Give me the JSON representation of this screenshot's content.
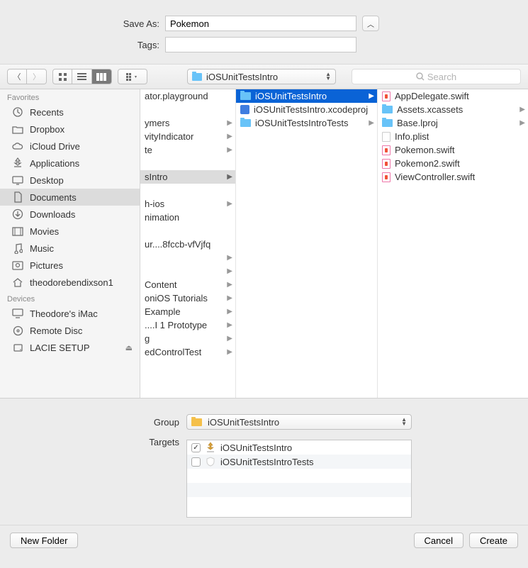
{
  "header": {
    "save_as_label": "Save As:",
    "save_as_value": "Pokemon",
    "tags_label": "Tags:",
    "tags_value": ""
  },
  "toolbar": {
    "path_label": "iOSUnitTestsIntro",
    "search_placeholder": "Search"
  },
  "sidebar": {
    "favorites_header": "Favorites",
    "devices_header": "Devices",
    "favorites": [
      {
        "label": "Recents",
        "icon": "clock"
      },
      {
        "label": "Dropbox",
        "icon": "folder-gray"
      },
      {
        "label": "iCloud Drive",
        "icon": "cloud"
      },
      {
        "label": "Applications",
        "icon": "apps"
      },
      {
        "label": "Desktop",
        "icon": "desktop"
      },
      {
        "label": "Documents",
        "icon": "doc",
        "selected": true
      },
      {
        "label": "Downloads",
        "icon": "download"
      },
      {
        "label": "Movies",
        "icon": "movie"
      },
      {
        "label": "Music",
        "icon": "music"
      },
      {
        "label": "Pictures",
        "icon": "picture"
      },
      {
        "label": "theodorebendixson1",
        "icon": "home"
      }
    ],
    "devices": [
      {
        "label": "Theodore's iMac",
        "icon": "imac"
      },
      {
        "label": "Remote Disc",
        "icon": "disc"
      },
      {
        "label": "LACIE SETUP",
        "icon": "drive",
        "eject": true
      }
    ]
  },
  "columns": {
    "col1": [
      {
        "label": "ator.playground",
        "type": "file"
      },
      {
        "label": "",
        "type": "spacer"
      },
      {
        "label": "ymers",
        "type": "folder",
        "arrow": true
      },
      {
        "label": "vityIndicator",
        "type": "folder",
        "arrow": true
      },
      {
        "label": "te",
        "type": "folder",
        "arrow": true
      },
      {
        "label": "",
        "type": "spacer"
      },
      {
        "label": "sIntro",
        "type": "folder",
        "arrow": true,
        "selected": true
      },
      {
        "label": "",
        "type": "spacer"
      },
      {
        "label": "h-ios",
        "type": "folder",
        "arrow": true
      },
      {
        "label": "nimation",
        "type": "text"
      },
      {
        "label": "",
        "type": "spacer"
      },
      {
        "label": "ur....8fccb-vfVjfq",
        "type": "text"
      },
      {
        "label": "",
        "type": "folder",
        "arrow": true
      },
      {
        "label": "",
        "type": "folder",
        "arrow": true
      },
      {
        "label": " Content",
        "type": "folder",
        "arrow": true
      },
      {
        "label": "oniOS Tutorials",
        "type": "folder",
        "arrow": true
      },
      {
        "label": "Example",
        "type": "folder",
        "arrow": true
      },
      {
        "label": "....I 1 Prototype",
        "type": "folder",
        "arrow": true
      },
      {
        "label": "g",
        "type": "folder",
        "arrow": true
      },
      {
        "label": "edControlTest",
        "type": "folder",
        "arrow": true
      }
    ],
    "col2": [
      {
        "label": "iOSUnitTestsIntro",
        "type": "folder",
        "arrow": true,
        "highlight": true
      },
      {
        "label": "iOSUnitTestsIntro.xcodeproj",
        "type": "proj"
      },
      {
        "label": "iOSUnitTestsIntroTests",
        "type": "folder",
        "arrow": true
      }
    ],
    "col3": [
      {
        "label": "AppDelegate.swift",
        "type": "swift"
      },
      {
        "label": "Assets.xcassets",
        "type": "folder",
        "arrow": true
      },
      {
        "label": "Base.lproj",
        "type": "folder",
        "arrow": true
      },
      {
        "label": "Info.plist",
        "type": "file"
      },
      {
        "label": "Pokemon.swift",
        "type": "swift"
      },
      {
        "label": "Pokemon2.swift",
        "type": "swift"
      },
      {
        "label": "ViewController.swift",
        "type": "swift"
      }
    ]
  },
  "bottom": {
    "group_label": "Group",
    "group_value": "iOSUnitTestsIntro",
    "targets_label": "Targets",
    "targets": [
      {
        "label": "iOSUnitTestsIntro",
        "checked": true,
        "icon": "app"
      },
      {
        "label": "iOSUnitTestsIntroTests",
        "checked": false,
        "icon": "test"
      }
    ]
  },
  "footer": {
    "new_folder": "New Folder",
    "cancel": "Cancel",
    "create": "Create"
  }
}
